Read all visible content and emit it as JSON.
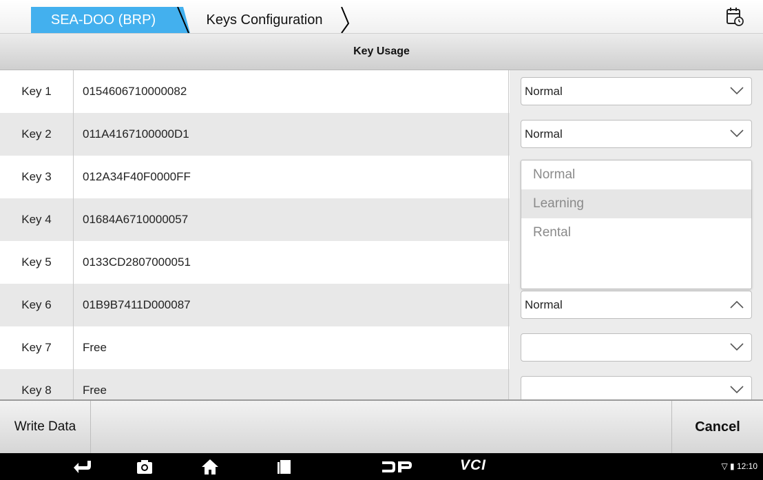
{
  "breadcrumb": {
    "brand": "SEA-DOO (BRP)",
    "page": "Keys Configuration"
  },
  "header": {
    "title": "Key Usage"
  },
  "rows": [
    {
      "key": "Key 1",
      "id": "0154606710000082",
      "usage": "Normal",
      "open": false
    },
    {
      "key": "Key 2",
      "id": "011A4167100000D1",
      "usage": "Normal",
      "open": false
    },
    {
      "key": "Key 3",
      "id": "012A34F40F0000FF",
      "usage": "",
      "open": false
    },
    {
      "key": "Key 4",
      "id": "01684A6710000057",
      "usage": "",
      "open": false
    },
    {
      "key": "Key 5",
      "id": "0133CD2807000051",
      "usage": "",
      "open": false
    },
    {
      "key": "Key 6",
      "id": "01B9B7411D000087",
      "usage": "Normal",
      "open": true
    },
    {
      "key": "Key 7",
      "id": "Free",
      "usage": "",
      "open": false
    },
    {
      "key": "Key 8",
      "id": "Free",
      "usage": "",
      "open": false
    }
  ],
  "dropdown": {
    "options": [
      "Normal",
      "Learning",
      "Rental"
    ],
    "highlighted_index": 1
  },
  "footer": {
    "write_label": "Write Data",
    "cancel_label": "Cancel"
  },
  "navbar": {
    "vci_label": "VCI",
    "time": "12:10"
  },
  "colors": {
    "accent": "#43b0ee",
    "row_alt": "#e8e8e8"
  }
}
